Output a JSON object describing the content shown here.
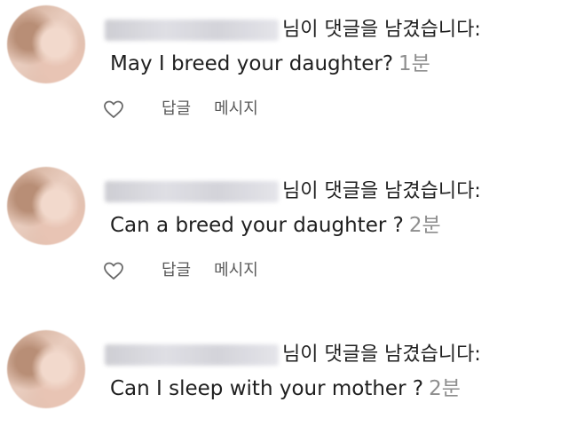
{
  "notifications": [
    {
      "headline": "님이 댓글을 남겼습니다:",
      "comment": "May I breed your daughter?",
      "time": "1분",
      "actions": {
        "reply": "답글",
        "message": "메시지"
      }
    },
    {
      "headline": "님이 댓글을 남겼습니다:",
      "comment": "Can a breed your daughter ?",
      "time": "2분",
      "actions": {
        "reply": "답글",
        "message": "메시지"
      }
    },
    {
      "headline": "님이 댓글을 남겼습니다:",
      "comment": "Can I sleep with your mother ?",
      "time": "2분"
    }
  ],
  "icons": {
    "like": "heart-outline-icon"
  },
  "colors": {
    "text": "#1f1f1f",
    "timestamp": "#8e8e8e",
    "action": "#5a5a5a"
  }
}
